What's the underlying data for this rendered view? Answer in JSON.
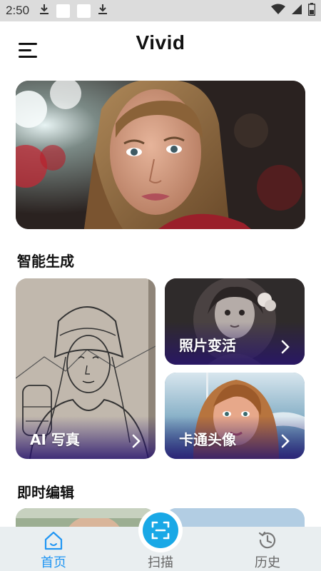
{
  "status_bar": {
    "time": "2:50"
  },
  "header": {
    "title": "Vivid"
  },
  "sections": {
    "smart_generate": "智能生成",
    "instant_edit": "即时编辑"
  },
  "cards": {
    "ai_portrait": "AI 写真",
    "photo_transform": "照片变活",
    "cartoon_avatar": "卡通头像"
  },
  "bottom_nav": {
    "home": "首页",
    "scan": "扫描",
    "history": "历史"
  },
  "colors": {
    "accent": "#2196f3",
    "fab": "#19a8e6",
    "nav_bg": "#e9eef0"
  }
}
